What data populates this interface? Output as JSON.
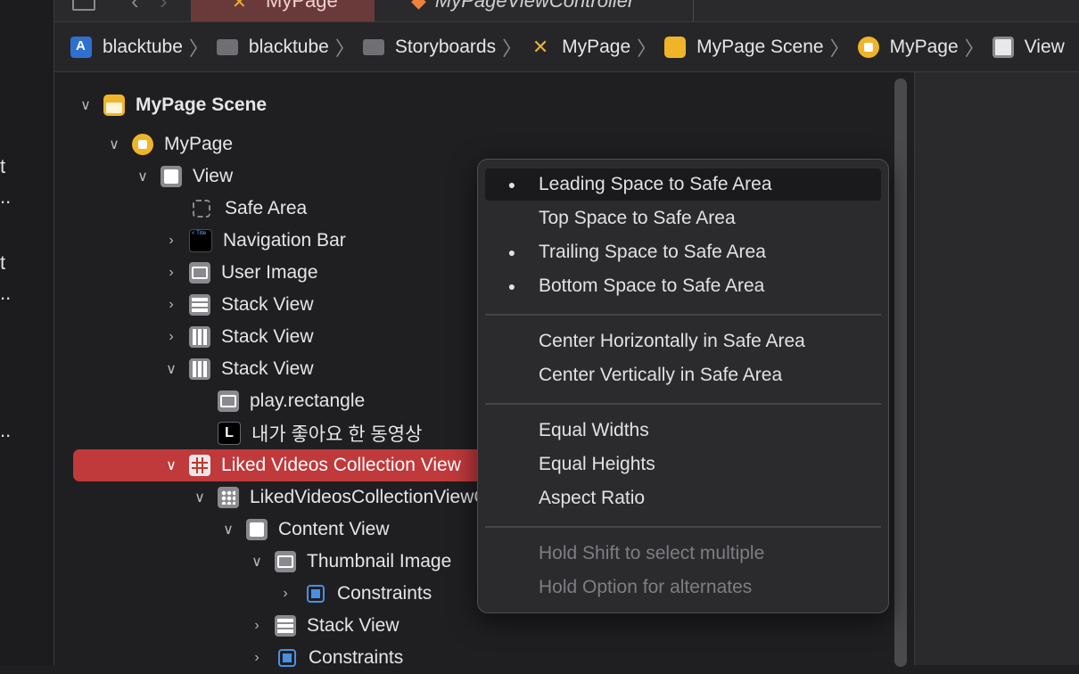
{
  "left_fragments": [
    "t",
    "..",
    "t",
    "..",
    ".."
  ],
  "tabs": [
    {
      "label": "MyPage",
      "active": true
    },
    {
      "label": "MyPageViewController",
      "active": false
    }
  ],
  "breadcrumb": [
    {
      "label": "blacktube",
      "icon": "app-icon"
    },
    {
      "label": "blacktube",
      "icon": "folder-icon"
    },
    {
      "label": "Storyboards",
      "icon": "folder-icon"
    },
    {
      "label": "MyPage",
      "icon": "storyboard-icon"
    },
    {
      "label": "MyPage Scene",
      "icon": "scene-icon"
    },
    {
      "label": "MyPage",
      "icon": "view-controller-icon"
    },
    {
      "label": "View",
      "icon": "view-icon"
    }
  ],
  "outline": {
    "scene": "MyPage Scene",
    "vc": "MyPage",
    "view": "View",
    "safe_area": "Safe Area",
    "navbar": "Navigation Bar",
    "user_image": "User Image",
    "stack1": "Stack View",
    "stack2": "Stack View",
    "stack3": "Stack View",
    "play": "play.rectangle",
    "label": "내가 좋아요 한 동영상",
    "label_icon": "L",
    "collection": "Liked Videos Collection View",
    "cell": "LikedVideosCollectionViewCell",
    "content": "Content View",
    "thumb": "Thumbnail Image",
    "thumb_constraints": "Constraints",
    "stack4": "Stack View",
    "constraints": "Constraints"
  },
  "menu": {
    "leading": "Leading Space to Safe Area",
    "top": "Top Space to Safe Area",
    "trailing": "Trailing Space to Safe Area",
    "bottom": "Bottom Space to Safe Area",
    "center_h": "Center Horizontally in Safe Area",
    "center_v": "Center Vertically in Safe Area",
    "equal_widths": "Equal Widths",
    "equal_heights": "Equal Heights",
    "aspect": "Aspect Ratio",
    "hint_shift": "Hold Shift to select multiple",
    "hint_option": "Hold Option for alternates",
    "bullet": "●"
  },
  "colors": {
    "selection": "#c0393b",
    "accent_yellow": "#f0b429",
    "constraint_blue": "#4a90e2"
  }
}
